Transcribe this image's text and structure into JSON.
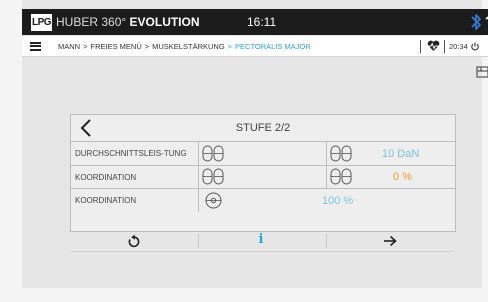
{
  "topbar": {
    "logo": "LPG",
    "brand_prefix": "HUBER 360°",
    "brand_main": "EVOLUTION",
    "time": "16:11"
  },
  "navbar": {
    "breadcrumbs": [
      "MANN",
      "FREIES MENÜ",
      "MUSKELSTÄRKUNG"
    ],
    "active": "PECTORALIS MAJOR",
    "separator": ">",
    "time": "20:34"
  },
  "panel": {
    "stage": "STUFE 2/2",
    "rows": [
      {
        "label": "DURCHSCHNITTSLEIS-TUNG",
        "value": "10 DaN",
        "value_color": "#7cc3e3"
      },
      {
        "label": "KOORDINATION",
        "value": "0 %",
        "value_color": "#f39c33"
      },
      {
        "label": "KOORDINATION",
        "value": "100 %",
        "value_color": "#7cc3e3"
      }
    ]
  },
  "footer": {
    "info": "i"
  },
  "colors": {
    "accent": "#2aa3d8",
    "topbar_bg": "#1c1c1c",
    "bluetooth": "#2f7de1"
  },
  "icons": [
    "menu-icon",
    "bluetooth-icon",
    "wifi-icon",
    "heart-monitor-icon",
    "power-icon",
    "save-icon",
    "back-arrow-icon",
    "pads-icon",
    "reset-icon",
    "info-icon",
    "next-arrow-icon"
  ]
}
